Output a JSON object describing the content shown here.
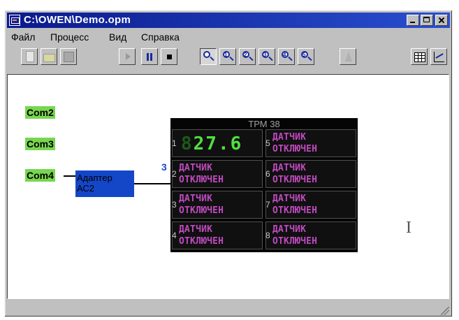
{
  "window": {
    "title": "C:\\OWEN\\Demo.opm"
  },
  "menu": [
    "Файл",
    "Процесс",
    "Вид",
    "Справка"
  ],
  "toolbar": {
    "buttons": [
      "new-file",
      "open-file",
      "save-file",
      "start",
      "pause",
      "stop",
      "zoom",
      "zoom-1",
      "zoom-2",
      "zoom-3",
      "zoom-4",
      "zoom-5",
      "flask",
      "table-view",
      "chart-view"
    ],
    "zoom_numbers": [
      "1",
      "2",
      "3",
      "4",
      "5"
    ]
  },
  "ports": [
    "Com2",
    "Com3",
    "Com4"
  ],
  "adapter": {
    "line1": "Адаптер",
    "line2": "АС2"
  },
  "connection_number": "3",
  "device": {
    "title": "ТРМ 38",
    "channels": [
      {
        "num": "1",
        "value": "27.6",
        "dim": "8",
        "line1": "",
        "line2": ""
      },
      {
        "num": "5",
        "line1": "ДАТЧИК",
        "line2": "ОТКЛЮЧЕН"
      },
      {
        "num": "2",
        "line1": "ДАТЧИК",
        "line2": "ОТКЛЮЧЕН"
      },
      {
        "num": "6",
        "line1": "ДАТЧИК",
        "line2": "ОТКЛЮЧЕН"
      },
      {
        "num": "3",
        "line1": "ДАТЧИК",
        "line2": "ОТКЛЮЧЕН"
      },
      {
        "num": "7",
        "line1": "ДАТЧИК",
        "line2": "ОТКЛЮЧЕН"
      },
      {
        "num": "4",
        "line1": "ДАТЧИК",
        "line2": "ОТКЛЮЧЕН"
      },
      {
        "num": "8",
        "line1": "ДАТЧИК",
        "line2": "ОТКЛЮЧЕН"
      }
    ]
  },
  "colors": {
    "titlebar": "#0a1a8c",
    "port": "#78d650",
    "adapter": "#1446c8",
    "segment": "#50e040",
    "sensor_text": "#c04ac0"
  }
}
